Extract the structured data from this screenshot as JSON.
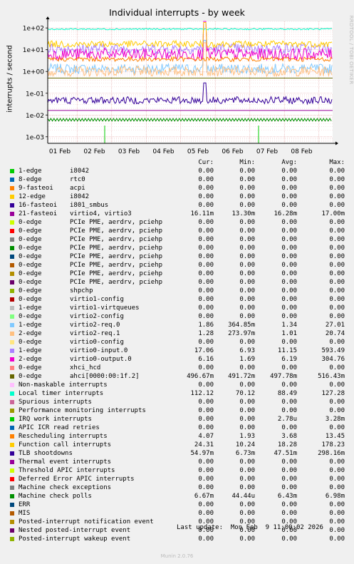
{
  "chart_data": {
    "type": "line",
    "title": "Individual interrupts - by week",
    "ylabel": "interrupts / second",
    "yscale": "log",
    "ylim": [
      0.0005,
      200
    ],
    "y_ticks": [
      "1e+02",
      "1e+01",
      "1e+00",
      "1e-01",
      "1e-02",
      "1e-03"
    ],
    "x_ticks": [
      "01 Feb",
      "02 Feb",
      "03 Feb",
      "04 Feb",
      "05 Feb",
      "06 Feb",
      "07 Feb",
      "08 Feb"
    ],
    "grid": true,
    "legend_placement": "bottom",
    "columns": [
      "Cur:",
      "Min:",
      "Avg:",
      "Max:"
    ],
    "series": [
      {
        "name": "1-edge",
        "device": "i8042",
        "color": "#00cc00",
        "cur": "0.00",
        "min": "0.00",
        "avg": "0.00",
        "max": "0.00"
      },
      {
        "name": "8-edge",
        "device": "rtc0",
        "color": "#0066b3",
        "cur": "0.00",
        "min": "0.00",
        "avg": "0.00",
        "max": "0.00"
      },
      {
        "name": "9-fasteoi",
        "device": "acpi",
        "color": "#ff8000",
        "cur": "0.00",
        "min": "0.00",
        "avg": "0.00",
        "max": "0.00"
      },
      {
        "name": "12-edge",
        "device": "i8042",
        "color": "#ffcc00",
        "cur": "0.00",
        "min": "0.00",
        "avg": "0.00",
        "max": "0.00"
      },
      {
        "name": "16-fasteoi",
        "device": "i801_smbus",
        "color": "#330099",
        "cur": "0.00",
        "min": "0.00",
        "avg": "0.00",
        "max": "0.00"
      },
      {
        "name": "21-fasteoi",
        "device": "virtio4, virtio3",
        "color": "#990099",
        "cur": "16.11m",
        "min": "13.30m",
        "avg": "16.28m",
        "max": "17.00m"
      },
      {
        "name": "0-edge",
        "device": "PCIe PME, aerdrv, pciehp",
        "color": "#ccff00",
        "cur": "0.00",
        "min": "0.00",
        "avg": "0.00",
        "max": "0.00"
      },
      {
        "name": "0-edge",
        "device": "PCIe PME, aerdrv, pciehp",
        "color": "#ff0000",
        "cur": "0.00",
        "min": "0.00",
        "avg": "0.00",
        "max": "0.00"
      },
      {
        "name": "0-edge",
        "device": "PCIe PME, aerdrv, pciehp",
        "color": "#808080",
        "cur": "0.00",
        "min": "0.00",
        "avg": "0.00",
        "max": "0.00"
      },
      {
        "name": "0-edge",
        "device": "PCIe PME, aerdrv, pciehp",
        "color": "#008f00",
        "cur": "0.00",
        "min": "0.00",
        "avg": "0.00",
        "max": "0.00"
      },
      {
        "name": "0-edge",
        "device": "PCIe PME, aerdrv, pciehp",
        "color": "#00487d",
        "cur": "0.00",
        "min": "0.00",
        "avg": "0.00",
        "max": "0.00"
      },
      {
        "name": "0-edge",
        "device": "PCIe PME, aerdrv, pciehp",
        "color": "#b35a00",
        "cur": "0.00",
        "min": "0.00",
        "avg": "0.00",
        "max": "0.00"
      },
      {
        "name": "0-edge",
        "device": "PCIe PME, aerdrv, pciehp",
        "color": "#b38f00",
        "cur": "0.00",
        "min": "0.00",
        "avg": "0.00",
        "max": "0.00"
      },
      {
        "name": "0-edge",
        "device": "PCIe PME, aerdrv, pciehp",
        "color": "#6b006b",
        "cur": "0.00",
        "min": "0.00",
        "avg": "0.00",
        "max": "0.00"
      },
      {
        "name": "0-edge",
        "device": "shpchp",
        "color": "#8fb300",
        "cur": "0.00",
        "min": "0.00",
        "avg": "0.00",
        "max": "0.00"
      },
      {
        "name": "0-edge",
        "device": "virtio1-config",
        "color": "#b30000",
        "cur": "0.00",
        "min": "0.00",
        "avg": "0.00",
        "max": "0.00"
      },
      {
        "name": "1-edge",
        "device": "virtio1-virtqueues",
        "color": "#bebebe",
        "cur": "0.00",
        "min": "0.00",
        "avg": "0.00",
        "max": "0.00"
      },
      {
        "name": "0-edge",
        "device": "virtio2-config",
        "color": "#80ff80",
        "cur": "0.00",
        "min": "0.00",
        "avg": "0.00",
        "max": "0.00"
      },
      {
        "name": "1-edge",
        "device": "virtio2-req.0",
        "color": "#80c9ff",
        "cur": "1.86",
        "min": "364.85m",
        "avg": "1.34",
        "max": "27.01"
      },
      {
        "name": "2-edge",
        "device": "virtio2-req.1",
        "color": "#ffc080",
        "cur": "1.28",
        "min": "273.97m",
        "avg": "1.01",
        "max": "20.74"
      },
      {
        "name": "0-edge",
        "device": "virtio0-config",
        "color": "#ffe680",
        "cur": "0.00",
        "min": "0.00",
        "avg": "0.00",
        "max": "0.00"
      },
      {
        "name": "1-edge",
        "device": "virtio0-input.0",
        "color": "#aa80ff",
        "cur": "17.06",
        "min": "6.93",
        "avg": "11.15",
        "max": "593.49"
      },
      {
        "name": "2-edge",
        "device": "virtio0-output.0",
        "color": "#ee00cc",
        "cur": "6.16",
        "min": "1.69",
        "avg": "6.19",
        "max": "304.76"
      },
      {
        "name": "0-edge",
        "device": "xhci_hcd",
        "color": "#ff8080",
        "cur": "0.00",
        "min": "0.00",
        "avg": "0.00",
        "max": "0.00"
      },
      {
        "name": "0-edge",
        "device": "ahci[0000:00:1f.2]",
        "color": "#666600",
        "cur": "496.67m",
        "min": "491.72m",
        "avg": "497.78m",
        "max": "516.43m"
      },
      {
        "name": "Non-maskable interrupts",
        "device": "",
        "color": "#ffbfff",
        "cur": "0.00",
        "min": "0.00",
        "avg": "0.00",
        "max": "0.00"
      },
      {
        "name": "Local timer interrupts",
        "device": "",
        "color": "#00ffcc",
        "cur": "112.12",
        "min": "70.12",
        "avg": "88.49",
        "max": "127.28"
      },
      {
        "name": "Spurious interrupts",
        "device": "",
        "color": "#cc6699",
        "cur": "0.00",
        "min": "0.00",
        "avg": "0.00",
        "max": "0.00"
      },
      {
        "name": "Performance monitoring interrupts",
        "device": "",
        "color": "#999900",
        "cur": "0.00",
        "min": "0.00",
        "avg": "0.00",
        "max": "0.00"
      },
      {
        "name": "IRQ work interrupts",
        "device": "",
        "color": "#00cc00",
        "cur": "0.00",
        "min": "0.00",
        "avg": "2.78u",
        "max": "3.28m"
      },
      {
        "name": "APIC ICR read retries",
        "device": "",
        "color": "#0066b3",
        "cur": "0.00",
        "min": "0.00",
        "avg": "0.00",
        "max": "0.00"
      },
      {
        "name": "Rescheduling interrupts",
        "device": "",
        "color": "#ff8000",
        "cur": "4.07",
        "min": "1.93",
        "avg": "3.68",
        "max": "13.45"
      },
      {
        "name": "Function call interrupts",
        "device": "",
        "color": "#ffcc00",
        "cur": "24.31",
        "min": "10.24",
        "avg": "18.28",
        "max": "178.23"
      },
      {
        "name": "TLB shootdowns",
        "device": "",
        "color": "#330099",
        "cur": "54.97m",
        "min": "6.73m",
        "avg": "47.51m",
        "max": "298.16m"
      },
      {
        "name": "Thermal event interrupts",
        "device": "",
        "color": "#990099",
        "cur": "0.00",
        "min": "0.00",
        "avg": "0.00",
        "max": "0.00"
      },
      {
        "name": "Threshold APIC interrupts",
        "device": "",
        "color": "#ccff00",
        "cur": "0.00",
        "min": "0.00",
        "avg": "0.00",
        "max": "0.00"
      },
      {
        "name": "Deferred Error APIC interrupts",
        "device": "",
        "color": "#ff0000",
        "cur": "0.00",
        "min": "0.00",
        "avg": "0.00",
        "max": "0.00"
      },
      {
        "name": "Machine check exceptions",
        "device": "",
        "color": "#808080",
        "cur": "0.00",
        "min": "0.00",
        "avg": "0.00",
        "max": "0.00"
      },
      {
        "name": "Machine check polls",
        "device": "",
        "color": "#008f00",
        "cur": "6.67m",
        "min": "44.44u",
        "avg": "6.43m",
        "max": "6.98m"
      },
      {
        "name": "ERR",
        "device": "",
        "color": "#00487d",
        "cur": "0.00",
        "min": "0.00",
        "avg": "0.00",
        "max": "0.00"
      },
      {
        "name": "MIS",
        "device": "",
        "color": "#b35a00",
        "cur": "0.00",
        "min": "0.00",
        "avg": "0.00",
        "max": "0.00"
      },
      {
        "name": "Posted-interrupt notification event",
        "device": "",
        "color": "#b38f00",
        "cur": "0.00",
        "min": "0.00",
        "avg": "0.00",
        "max": "0.00"
      },
      {
        "name": "Nested posted-interrupt event",
        "device": "",
        "color": "#6b006b",
        "cur": "0.00",
        "min": "0.00",
        "avg": "0.00",
        "max": "0.00"
      },
      {
        "name": "Posted-interrupt wakeup event",
        "device": "",
        "color": "#8fb300",
        "cur": "0.00",
        "min": "0.00",
        "avg": "0.00",
        "max": "0.00"
      }
    ]
  },
  "watermark": "RRDTOOL / TOBI OETIKER",
  "last_update": "Last update:  Mon Feb  9 11:00:02 2026",
  "version": "Munin 2.0.76"
}
